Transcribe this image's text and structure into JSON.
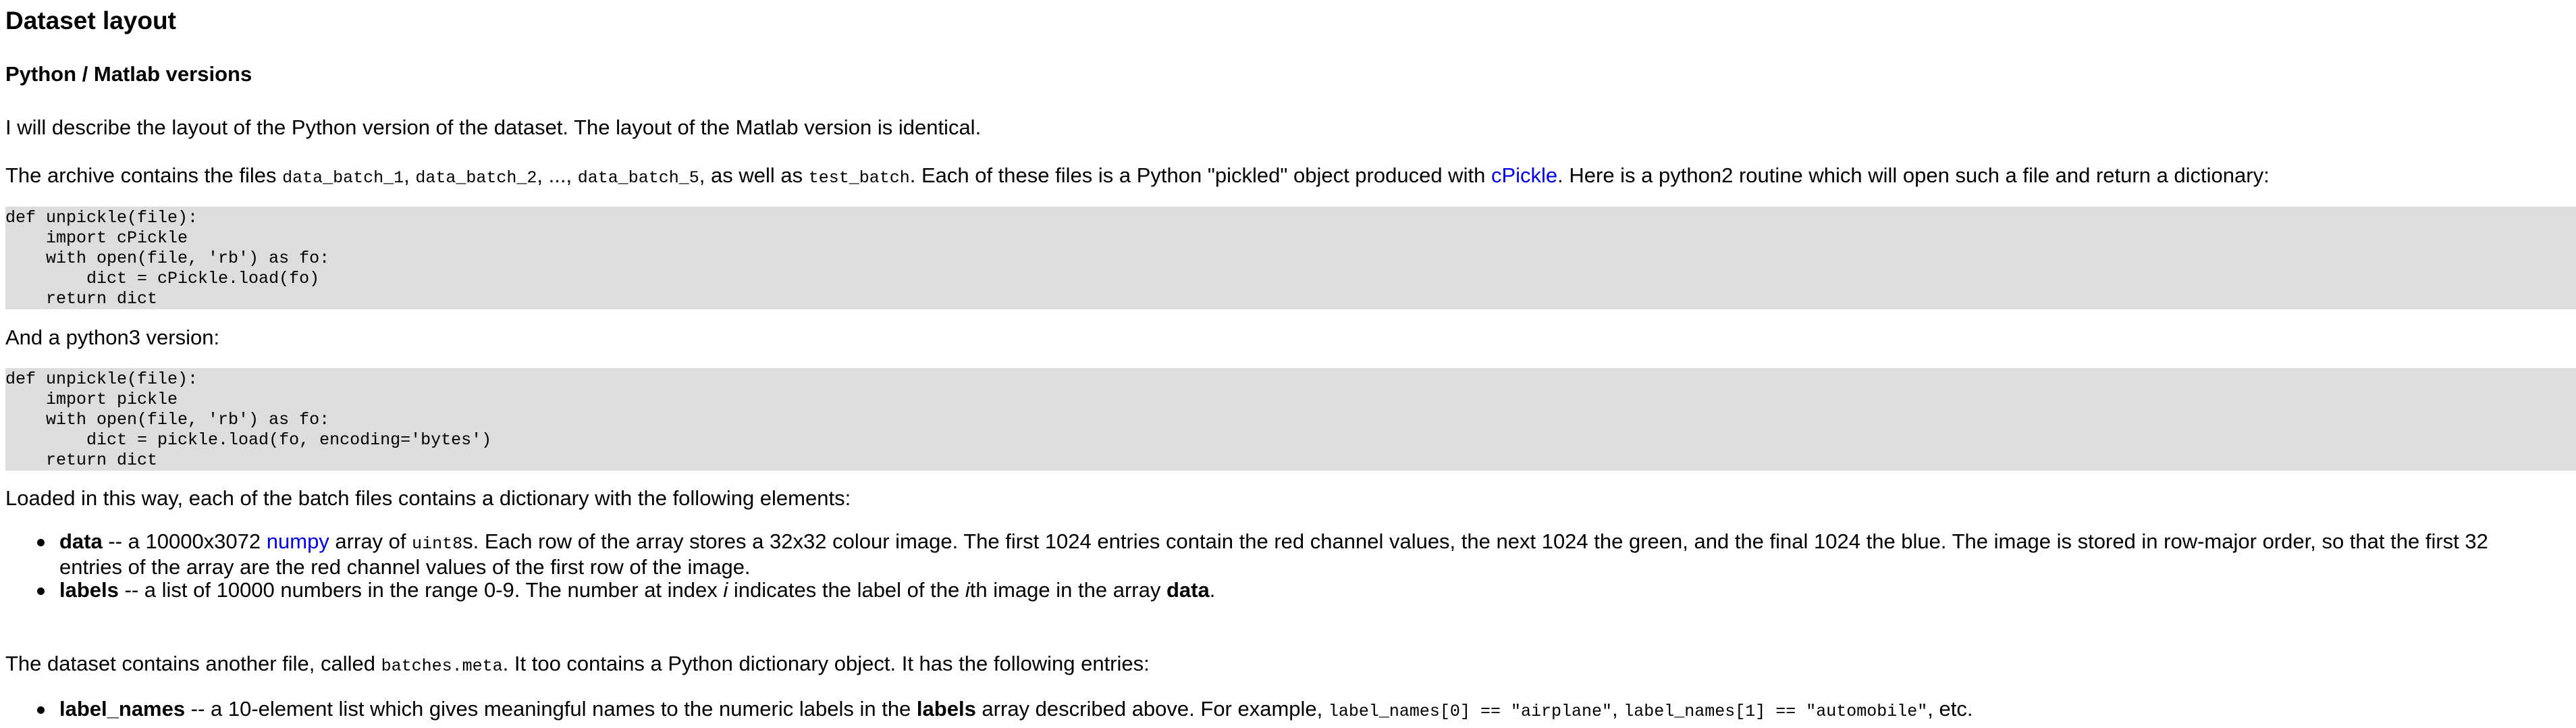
{
  "heading": "Dataset layout",
  "subheading": "Python / Matlab versions",
  "intro": "I will describe the layout of the Python version of the dataset. The layout of the Matlab version is identical.",
  "archive_para": {
    "t1": "The archive contains the files ",
    "file1": "data_batch_1",
    "t2": ", ",
    "file2": "data_batch_2",
    "t3": ", ..., ",
    "file5": "data_batch_5",
    "t4": ", as well as ",
    "test": "test_batch",
    "t5": ". Each of these files is a Python \"pickled\" object produced with ",
    "link": "cPickle",
    "t6": ". Here is a python2 routine which will open such a file and return a dictionary:"
  },
  "code_py2": "def unpickle(file):\n    import cPickle\n    with open(file, 'rb') as fo:\n        dict = cPickle.load(fo)\n    return dict",
  "py3_label": "And a python3 version:",
  "code_py3": "def unpickle(file):\n    import pickle\n    with open(file, 'rb') as fo:\n        dict = pickle.load(fo, encoding='bytes')\n    return dict",
  "loaded_para": "Loaded in this way, each of the batch files contains a dictionary with the following elements:",
  "batch_items": {
    "data": {
      "term": "data",
      "t1": " -- a 10000x3072 ",
      "link": "numpy",
      "t2": " array of ",
      "code": "uint8",
      "t3": "s. Each row of the array stores a 32x32 colour image. The first 1024 entries contain the red channel values, the next 1024 the green, and the final 1024 the blue. The image is stored in row-major order, so that the first 32",
      "t4": "entries of the array are the red channel values of the first row of the image."
    },
    "labels": {
      "term": "labels",
      "t1": " -- a list of 10000 numbers in the range 0-9. The number at index ",
      "i1": "i",
      "t2": " indicates the label of the ",
      "i2": "i",
      "t3": "th image in the array ",
      "b": "data",
      "t4": "."
    }
  },
  "meta_para": {
    "t1": "The dataset contains another file, called ",
    "code": "batches.meta",
    "t2": ". It too contains a Python dictionary object. It has the following entries:"
  },
  "meta_items": {
    "label_names": {
      "term": "label_names",
      "t1": " -- a 10-element list which gives meaningful names to the numeric labels in the ",
      "b": "labels",
      "t2": " array described above. For example, ",
      "code1": "label_names[0] == \"airplane\"",
      "t3": ", ",
      "code2": "label_names[1] == \"automobile\"",
      "t4": ", etc."
    }
  }
}
